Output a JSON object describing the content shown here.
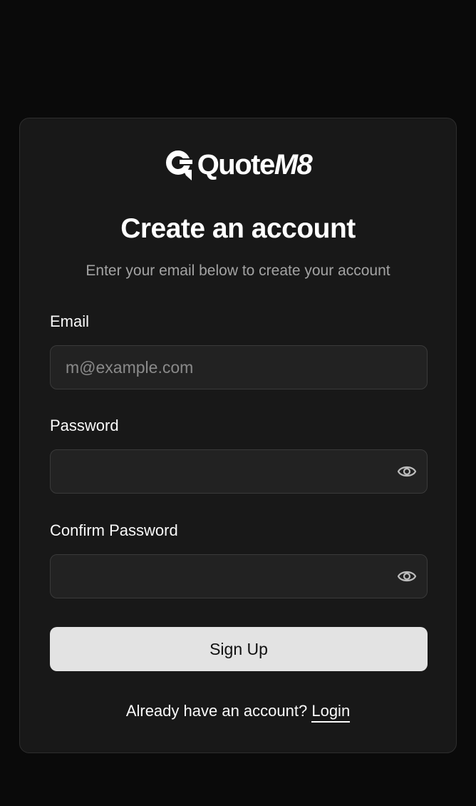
{
  "brand": {
    "logo_text_main": "Quote",
    "logo_text_accent": "M8",
    "logo_icon": "quote-bubble-icon"
  },
  "heading": {
    "title": "Create an account",
    "subtitle": "Enter your email below to create your account"
  },
  "form": {
    "email": {
      "label": "Email",
      "placeholder": "m@example.com",
      "value": ""
    },
    "password": {
      "label": "Password",
      "value": "",
      "toggle_icon": "eye-icon"
    },
    "confirm_password": {
      "label": "Confirm Password",
      "value": "",
      "toggle_icon": "eye-icon"
    },
    "submit_label": "Sign Up"
  },
  "footer": {
    "prompt": "Already have an account?",
    "link_label": "Login"
  },
  "colors": {
    "background": "#0a0a0a",
    "card": "#181818",
    "input_bg": "#222222",
    "button_bg": "#e3e3e3",
    "muted_text": "#a3a3a3"
  }
}
